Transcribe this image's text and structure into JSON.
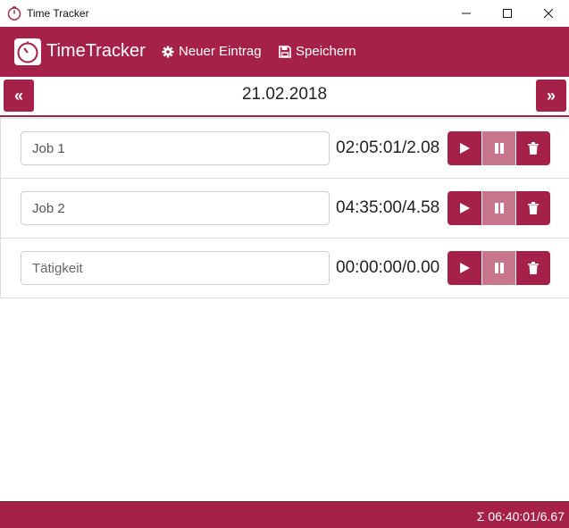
{
  "window": {
    "title": "Time Tracker"
  },
  "header": {
    "brand": "TimeTracker",
    "new_entry_label": "Neuer Eintrag",
    "save_label": "Speichern"
  },
  "datebar": {
    "date": "21.02.2018",
    "prev_label": "«",
    "next_label": "»"
  },
  "entries": [
    {
      "name": "Job 1",
      "placeholder": "Tätigkeit",
      "time": "02:05:01/2.08"
    },
    {
      "name": "Job 2",
      "placeholder": "Tätigkeit",
      "time": "04:35:00/4.58"
    },
    {
      "name": "",
      "placeholder": "Tätigkeit",
      "time": "00:00:00/0.00"
    }
  ],
  "footer": {
    "total": "Σ 06:40:01/6.67"
  },
  "colors": {
    "accent": "#a52149",
    "pause": "#c8758e"
  },
  "icons": [
    "timer-icon",
    "gear-icon",
    "floppy-disk-icon",
    "play-icon",
    "pause-icon",
    "trash-icon"
  ]
}
